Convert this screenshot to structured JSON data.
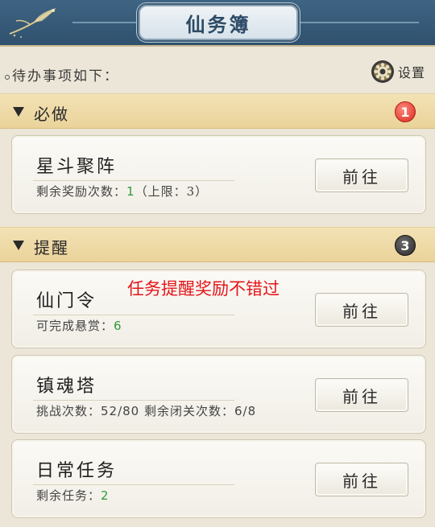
{
  "header": {
    "title": "仙务簿"
  },
  "subheader": {
    "todo_label": "待办事项如下：",
    "settings_label": "设置"
  },
  "sections": [
    {
      "label": "必做",
      "badge": "1",
      "cards": [
        {
          "title": "星斗聚阵",
          "sub_prefix": "剩余奖励次数：",
          "sub_value": "1",
          "sub_suffix": "（上限：3）",
          "button": "前往"
        }
      ]
    },
    {
      "label": "提醒",
      "badge": "3",
      "cards": [
        {
          "title": "仙门令",
          "sub_prefix": "可完成悬赏：",
          "sub_value": "6",
          "button": "前往"
        },
        {
          "title": "镇魂塔",
          "sub_text": "挑战次数：52/80  剩余闭关次数：6/8",
          "button": "前往"
        },
        {
          "title": "日常任务",
          "sub_prefix": "剩余任务：",
          "sub_value": "2",
          "button": "前往"
        }
      ]
    }
  ],
  "annotation": "任务提醒奖励不错过",
  "colors": {
    "header_bg": "#3f6483",
    "section_bg": "#ead39a",
    "badge_red": "#d62a1f",
    "badge_dark": "#2a2a2a",
    "value_green": "#2f9a3a",
    "annotation_red": "#e4151a"
  },
  "icons": {
    "settings": "gear-icon",
    "collapse": "triangle-down-icon",
    "logo": "crane-icon"
  }
}
